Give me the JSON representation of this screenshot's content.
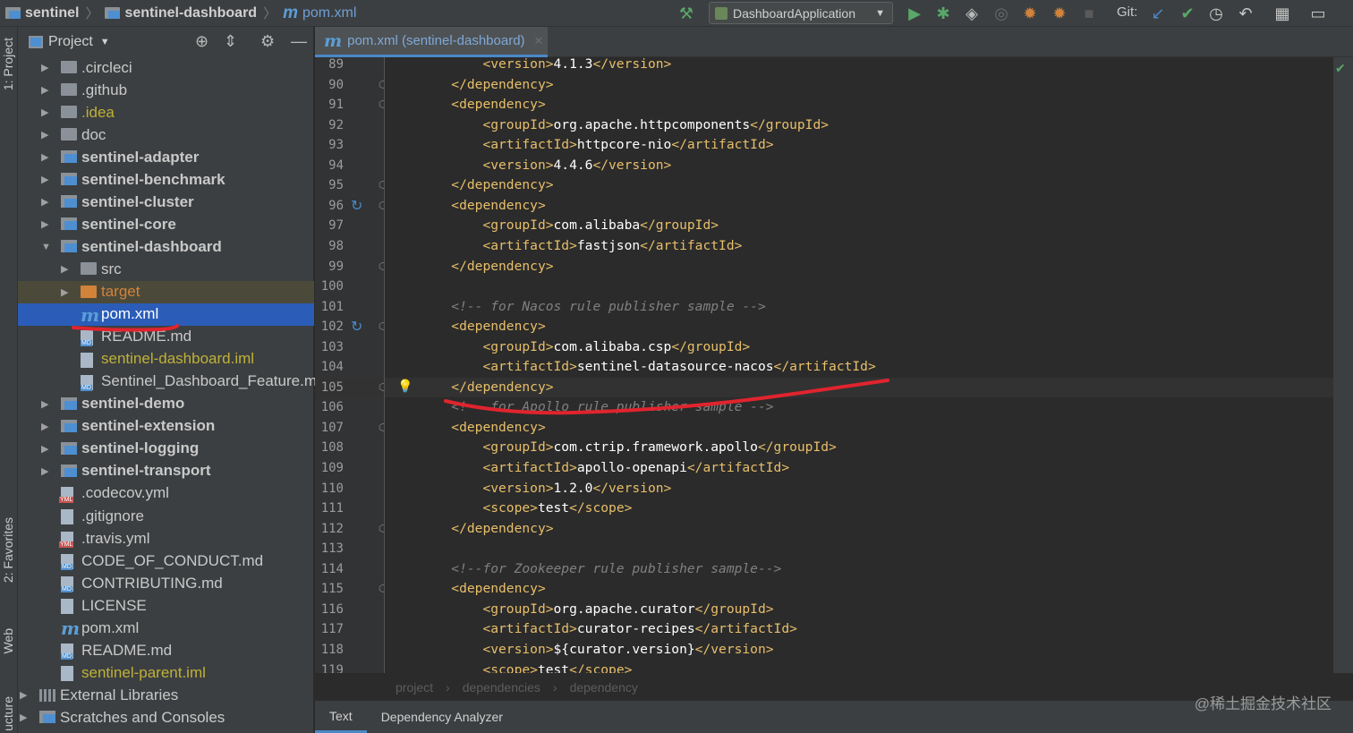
{
  "navbar": {
    "project": "sentinel",
    "module": "sentinel-dashboard",
    "file": "pom.xml",
    "file_icon": "m",
    "run_config": "DashboardApplication",
    "git_label": "Git:"
  },
  "left_strip": {
    "project_tab": "1: Project",
    "favorites_tab": "2: Favorites",
    "web_tab": "Web",
    "structure_tab": "ucture"
  },
  "project_panel": {
    "title": "Project",
    "tree": [
      {
        "label": ".circleci",
        "kind": "folder"
      },
      {
        "label": ".github",
        "kind": "folder"
      },
      {
        "label": ".idea",
        "kind": "folder"
      },
      {
        "label": "doc",
        "kind": "folder"
      },
      {
        "label": "sentinel-adapter",
        "kind": "module"
      },
      {
        "label": "sentinel-benchmark",
        "kind": "module"
      },
      {
        "label": "sentinel-cluster",
        "kind": "module"
      },
      {
        "label": "sentinel-core",
        "kind": "module"
      },
      {
        "label": "sentinel-dashboard",
        "kind": "module"
      },
      {
        "label": "src",
        "kind": "folder"
      },
      {
        "label": "target",
        "kind": "folder"
      },
      {
        "label": "pom.xml",
        "kind": "maven"
      },
      {
        "label": "README.md",
        "kind": "md"
      },
      {
        "label": "sentinel-dashboard.iml",
        "kind": "iml"
      },
      {
        "label": "Sentinel_Dashboard_Feature.md",
        "kind": "md"
      },
      {
        "label": "sentinel-demo",
        "kind": "module"
      },
      {
        "label": "sentinel-extension",
        "kind": "module"
      },
      {
        "label": "sentinel-logging",
        "kind": "module"
      },
      {
        "label": "sentinel-transport",
        "kind": "module"
      },
      {
        "label": ".codecov.yml",
        "kind": "yml"
      },
      {
        "label": ".gitignore",
        "kind": "file"
      },
      {
        "label": ".travis.yml",
        "kind": "yml"
      },
      {
        "label": "CODE_OF_CONDUCT.md",
        "kind": "md"
      },
      {
        "label": "CONTRIBUTING.md",
        "kind": "md"
      },
      {
        "label": "LICENSE",
        "kind": "file"
      },
      {
        "label": "pom.xml",
        "kind": "maven"
      },
      {
        "label": "README.md",
        "kind": "md"
      },
      {
        "label": "sentinel-parent.iml",
        "kind": "iml"
      },
      {
        "label": "External Libraries",
        "kind": "lib"
      },
      {
        "label": "Scratches and Consoles",
        "kind": "scratch"
      }
    ]
  },
  "editor": {
    "tab_label": "pom.xml (sentinel-dashboard)",
    "current_line": 105,
    "lines": [
      {
        "n": "89",
        "t": "            <version>4.1.3</version>"
      },
      {
        "n": "90",
        "t": "        </dependency>"
      },
      {
        "n": "91",
        "t": "        <dependency>"
      },
      {
        "n": "92",
        "t": "            <groupId>org.apache.httpcomponents</groupId>"
      },
      {
        "n": "93",
        "t": "            <artifactId>httpcore-nio</artifactId>"
      },
      {
        "n": "94",
        "t": "            <version>4.4.6</version>"
      },
      {
        "n": "95",
        "t": "        </dependency>"
      },
      {
        "n": "96",
        "t": "        <dependency>"
      },
      {
        "n": "97",
        "t": "            <groupId>com.alibaba</groupId>"
      },
      {
        "n": "98",
        "t": "            <artifactId>fastjson</artifactId>"
      },
      {
        "n": "99",
        "t": "        </dependency>"
      },
      {
        "n": "100",
        "t": ""
      },
      {
        "n": "101",
        "t": "        <!-- for Nacos rule publisher sample -->"
      },
      {
        "n": "102",
        "t": "        <dependency>"
      },
      {
        "n": "103",
        "t": "            <groupId>com.alibaba.csp</groupId>"
      },
      {
        "n": "104",
        "t": "            <artifactId>sentinel-datasource-nacos</artifactId>"
      },
      {
        "n": "105",
        "t": "        </dependency>"
      },
      {
        "n": "106",
        "t": "        <!-- for Apollo rule publisher sample -->"
      },
      {
        "n": "107",
        "t": "        <dependency>"
      },
      {
        "n": "108",
        "t": "            <groupId>com.ctrip.framework.apollo</groupId>"
      },
      {
        "n": "109",
        "t": "            <artifactId>apollo-openapi</artifactId>"
      },
      {
        "n": "110",
        "t": "            <version>1.2.0</version>"
      },
      {
        "n": "111",
        "t": "            <scope>test</scope>"
      },
      {
        "n": "112",
        "t": "        </dependency>"
      },
      {
        "n": "113",
        "t": ""
      },
      {
        "n": "114",
        "t": "        <!--for Zookeeper rule publisher sample-->"
      },
      {
        "n": "115",
        "t": "        <dependency>"
      },
      {
        "n": "116",
        "t": "            <groupId>org.apache.curator</groupId>"
      },
      {
        "n": "117",
        "t": "            <artifactId>curator-recipes</artifactId>"
      },
      {
        "n": "118",
        "t": "            <version>${curator.version}</version>"
      },
      {
        "n": "119",
        "t": "            <scope>test</scope>"
      }
    ]
  },
  "xml_breadcrumb": [
    "project",
    "dependencies",
    "dependency"
  ],
  "bottom_tabs": [
    "Text",
    "Dependency Analyzer"
  ],
  "watermark": "@稀土掘金技术社区",
  "colors": {
    "tag": "#e8bf6a",
    "text": "#ffffff",
    "comment": "#808080",
    "selection": "#2b5db8",
    "annotation": "#e0242e"
  }
}
